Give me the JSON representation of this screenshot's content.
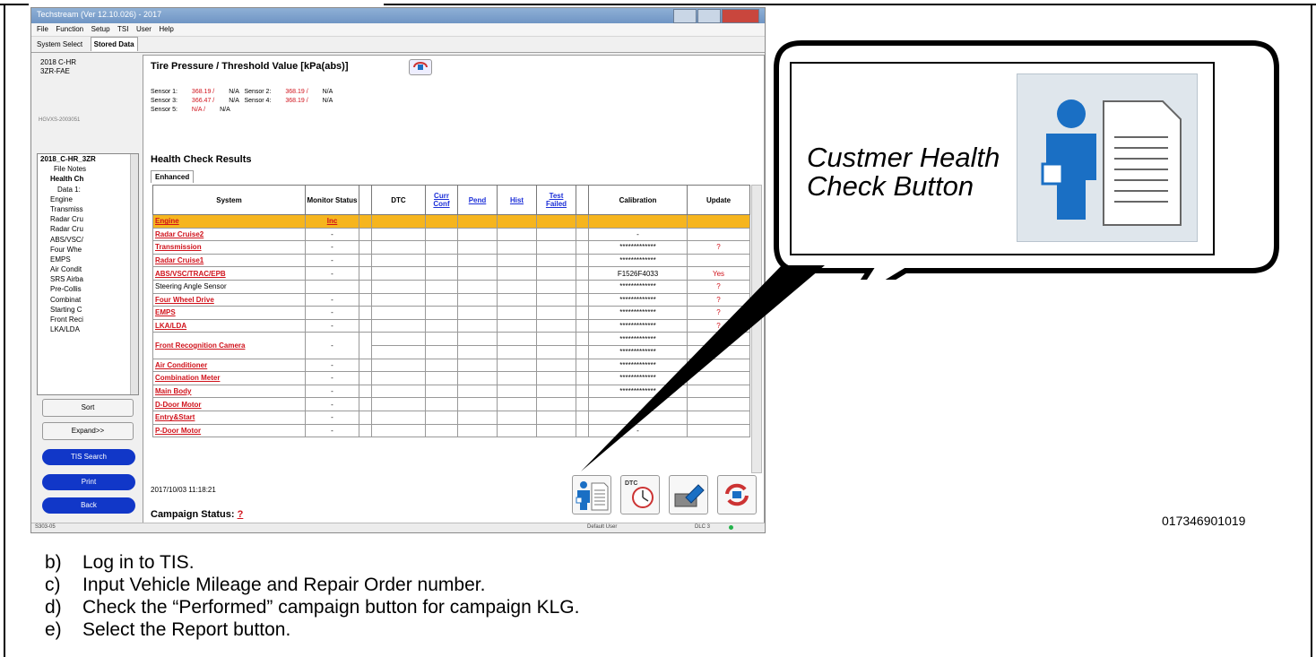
{
  "window": {
    "title": "Techstream (Ver 12.10.026) - 2017",
    "menu": [
      "File",
      "Function",
      "Setup",
      "TSI",
      "User",
      "Help"
    ],
    "tabs": [
      "System Select",
      "Stored Data"
    ]
  },
  "vehicle": {
    "model": "2018 C-HR",
    "engine": "3ZR-FAE",
    "vin": "HGVXS-2003051"
  },
  "tree": {
    "items": [
      "2018_C-HR_3ZR",
      "File Notes",
      "Health Ch",
      "Data 1:",
      "Engine",
      "Transmiss",
      "Radar Cru",
      "Radar Cru",
      "ABS/VSC/",
      "Four Whe",
      "EMPS",
      "Air Condit",
      "SRS Airba",
      "Pre-Collis",
      "Combinat",
      "Starting C",
      "Front Reci",
      "LKA/LDA"
    ]
  },
  "left_buttons": {
    "sort": "Sort",
    "expand": "Expand>>",
    "tis_search": "TIS Search",
    "print": "Print",
    "back": "Back"
  },
  "tire_pressure": {
    "title": "Tire Pressure / Threshold Value [kPa(abs)]",
    "sensors": [
      {
        "label": "Sensor 1:",
        "value": "368.19 /",
        "threshold": "N/A"
      },
      {
        "label": "Sensor 2:",
        "value": "368.19 /",
        "threshold": "N/A"
      },
      {
        "label": "Sensor 3:",
        "value": "366.47 /",
        "threshold": "N/A"
      },
      {
        "label": "Sensor 4:",
        "value": "368.19 /",
        "threshold": "N/A"
      },
      {
        "label": "Sensor 5:",
        "value": "N/A /",
        "threshold": "N/A"
      }
    ]
  },
  "health_check": {
    "title": "Health Check Results",
    "tab": "Enhanced",
    "columns": [
      "System",
      "Monitor Status",
      "DTC",
      "Curr Conf",
      "Pend",
      "Hist",
      "Test Failed",
      "Calibration",
      "Update"
    ],
    "rows": [
      {
        "system": "Engine",
        "monitor": "Inc",
        "calibration": "",
        "update": ""
      },
      {
        "system": "Radar Cruise2",
        "monitor": "-",
        "calibration": "-",
        "update": ""
      },
      {
        "system": "Transmission",
        "monitor": "-",
        "calibration": "*************",
        "update": "?"
      },
      {
        "system": "Radar Cruise1",
        "monitor": "-",
        "calibration": "*************",
        "update": ""
      },
      {
        "system": "ABS/VSC/TRAC/EPB",
        "monitor": "-",
        "calibration": "F1526F4033",
        "update": "Yes"
      },
      {
        "system": "Steering Angle Sensor",
        "monitor": "",
        "calibration": "*************",
        "update": "?"
      },
      {
        "system": "Four Wheel Drive",
        "monitor": "-",
        "calibration": "*************",
        "update": "?"
      },
      {
        "system": "EMPS",
        "monitor": "-",
        "calibration": "*************",
        "update": "?"
      },
      {
        "system": "LKA/LDA",
        "monitor": "-",
        "calibration": "*************",
        "update": "?"
      },
      {
        "system": "Front Recognition Camera",
        "monitor": "-",
        "calibration": "*************",
        "update": ""
      },
      {
        "system": "",
        "monitor": "",
        "calibration": "*************",
        "update": ""
      },
      {
        "system": "Air Conditioner",
        "monitor": "-",
        "calibration": "*************",
        "update": ""
      },
      {
        "system": "Combination Meter",
        "monitor": "-",
        "calibration": "*************",
        "update": ""
      },
      {
        "system": "Main Body",
        "monitor": "-",
        "calibration": "*************",
        "update": ""
      },
      {
        "system": "D-Door Motor",
        "monitor": "-",
        "calibration": "",
        "update": ""
      },
      {
        "system": "Entry&Start",
        "monitor": "-",
        "calibration": "",
        "update": ""
      },
      {
        "system": "P-Door Motor",
        "monitor": "-",
        "calibration": "-",
        "update": ""
      }
    ]
  },
  "footer": {
    "timestamp": "2017/10/03 11:18:21",
    "campaign_label": "Campaign Status:",
    "campaign_value": "?",
    "dtc_label": "DTC"
  },
  "statusbar": {
    "left": "S303-05",
    "user": "Default User",
    "dlc": "DLC 3"
  },
  "callout": {
    "line1": "Custmer Health",
    "line2": "Check Button"
  },
  "figure_number": "017346901019",
  "steps": [
    {
      "letter": "b)",
      "text": "Log in to TIS."
    },
    {
      "letter": "c)",
      "text": "Input Vehicle Mileage and Repair Order number."
    },
    {
      "letter": "d)",
      "text": "Check the “Performed” campaign button for campaign KLG."
    },
    {
      "letter": "e)",
      "text": "Select the Report button."
    }
  ],
  "colors": {
    "highlight": "#f6b51e",
    "link_red": "#d0121b",
    "button_blue": "#1137c8",
    "icon_blue": "#1a6fc4"
  }
}
